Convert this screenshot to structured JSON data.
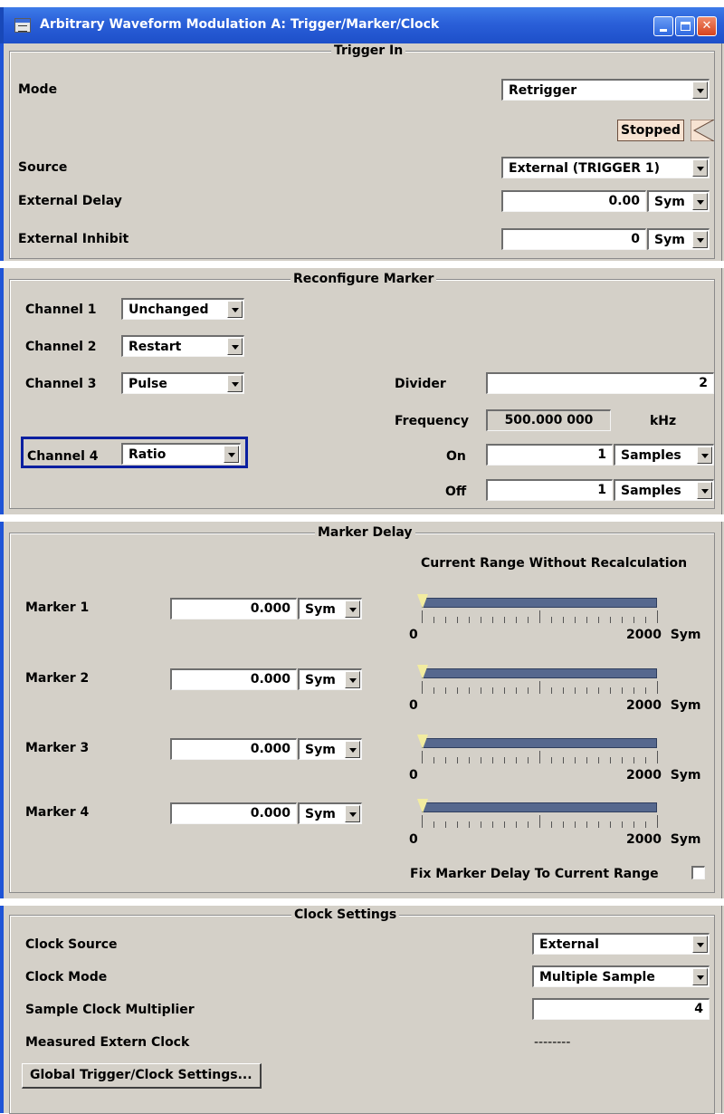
{
  "window": {
    "title": "Arbitrary Waveform Modulation  A: Trigger/Marker/Clock"
  },
  "trigger_in": {
    "group_title": "Trigger In",
    "mode_label": "Mode",
    "mode_value": "Retrigger",
    "status": "Stopped",
    "source_label": "Source",
    "source_value": "External (TRIGGER 1)",
    "ext_delay_label": "External Delay",
    "ext_delay_value": "0.00",
    "ext_delay_unit": "Sym",
    "ext_inhibit_label": "External Inhibit",
    "ext_inhibit_value": "0",
    "ext_inhibit_unit": "Sym"
  },
  "reconfigure_marker": {
    "group_title": "Reconfigure Marker",
    "channels": [
      {
        "label": "Channel 1",
        "value": "Unchanged"
      },
      {
        "label": "Channel 2",
        "value": "Restart"
      },
      {
        "label": "Channel 3",
        "value": "Pulse"
      },
      {
        "label": "Channel 4",
        "value": "Ratio"
      }
    ],
    "divider_label": "Divider",
    "divider_value": "2",
    "frequency_label": "Frequency",
    "frequency_value": "500.000 000",
    "frequency_unit": "kHz",
    "on_label": "On",
    "on_value": "1",
    "on_unit": "Samples",
    "off_label": "Off",
    "off_value": "1",
    "off_unit": "Samples"
  },
  "marker_delay": {
    "group_title": "Marker Delay",
    "range_heading": "Current Range Without Recalculation",
    "markers": [
      {
        "label": "Marker 1",
        "value": "0.000",
        "unit": "Sym",
        "range_min": "0",
        "range_max": "2000  Sym",
        "fraction": 0
      },
      {
        "label": "Marker 2",
        "value": "0.000",
        "unit": "Sym",
        "range_min": "0",
        "range_max": "2000  Sym",
        "fraction": 0
      },
      {
        "label": "Marker 3",
        "value": "0.000",
        "unit": "Sym",
        "range_min": "0",
        "range_max": "2000  Sym",
        "fraction": 0
      },
      {
        "label": "Marker 4",
        "value": "0.000",
        "unit": "Sym",
        "range_min": "0",
        "range_max": "2000  Sym",
        "fraction": 0
      }
    ],
    "fix_label": "Fix Marker Delay To Current Range",
    "fix_checked": false
  },
  "clock_settings": {
    "group_title": "Clock Settings",
    "clock_source_label": "Clock Source",
    "clock_source_value": "External",
    "clock_mode_label": "Clock Mode",
    "clock_mode_value": "Multiple Sample",
    "multiplier_label": "Sample Clock Multiplier",
    "multiplier_value": "4",
    "measured_label": "Measured Extern Clock",
    "measured_value": "--------",
    "global_button": "Global Trigger/Clock Settings..."
  },
  "colors": {
    "panel_bg": "#d4d0c8",
    "title_blue": "#2a5fd8",
    "focus": "#0a1fa0",
    "slider_track": "#56688e"
  }
}
